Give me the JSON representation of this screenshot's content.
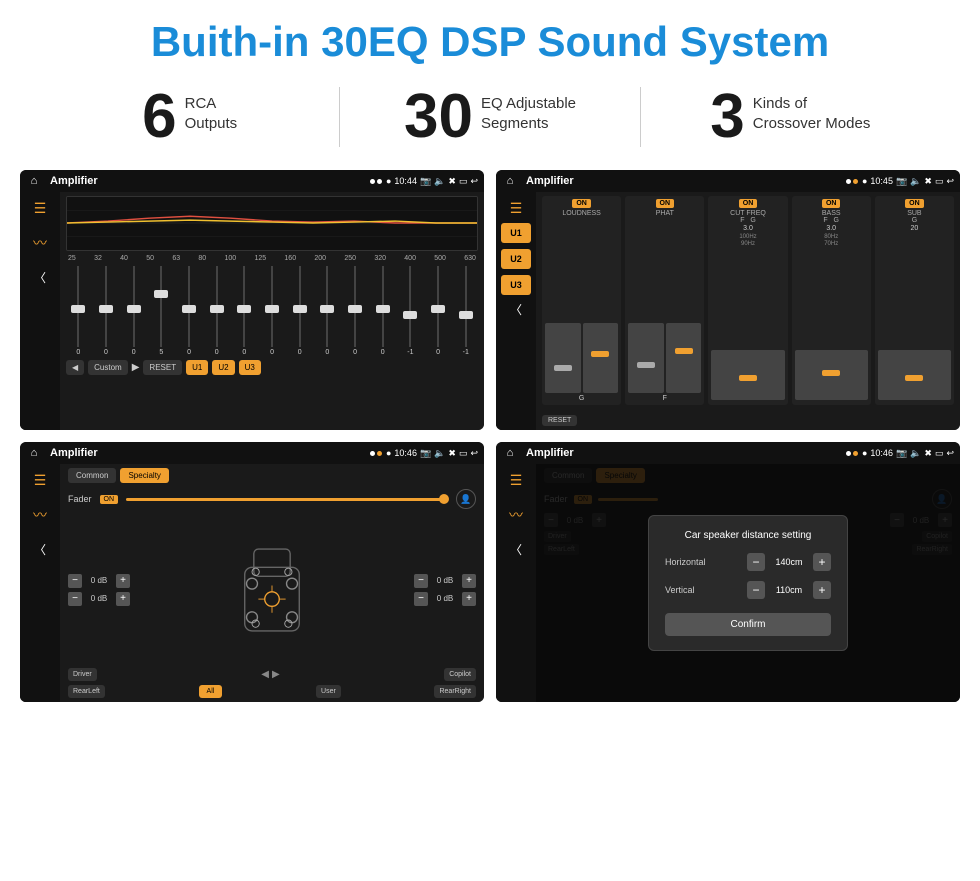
{
  "page": {
    "title": "Buith-in 30EQ DSP Sound System",
    "stats": [
      {
        "number": "6",
        "label": "RCA\nOutputs"
      },
      {
        "number": "30",
        "label": "EQ Adjustable\nSegments"
      },
      {
        "number": "3",
        "label": "Kinds of\nCrossover Modes"
      }
    ],
    "screens": [
      {
        "id": "screen1",
        "status_bar": {
          "time": "10:44",
          "title": "Amplifier"
        },
        "eq_labels": [
          "25",
          "32",
          "40",
          "50",
          "63",
          "80",
          "100",
          "125",
          "160",
          "200",
          "250",
          "320",
          "400",
          "500",
          "630"
        ],
        "eq_values": [
          "0",
          "0",
          "0",
          "5",
          "0",
          "0",
          "0",
          "0",
          "0",
          "0",
          "0",
          "0",
          "-1",
          "0",
          "-1"
        ],
        "eq_preset": "Custom",
        "buttons": [
          "RESET",
          "U1",
          "U2",
          "U3"
        ]
      },
      {
        "id": "screen2",
        "status_bar": {
          "time": "10:45",
          "title": "Amplifier"
        },
        "channels": [
          "LOUDNESS",
          "PHAT",
          "CUT FREQ",
          "BASS",
          "SUB"
        ],
        "u_buttons": [
          "U1",
          "U2",
          "U3"
        ],
        "reset_label": "RESET"
      },
      {
        "id": "screen3",
        "status_bar": {
          "time": "10:46",
          "title": "Amplifier"
        },
        "tabs": [
          "Common",
          "Specialty"
        ],
        "fader_label": "Fader",
        "fader_on": "ON",
        "db_values": [
          "0 dB",
          "0 dB",
          "0 dB",
          "0 dB"
        ],
        "buttons": [
          "Driver",
          "Copilot",
          "RearLeft",
          "All",
          "User",
          "RearRight"
        ]
      },
      {
        "id": "screen4",
        "status_bar": {
          "time": "10:46",
          "title": "Amplifier"
        },
        "tabs": [
          "Common",
          "Specialty"
        ],
        "fader_on": "ON",
        "dialog": {
          "title": "Car speaker distance setting",
          "horizontal_label": "Horizontal",
          "horizontal_value": "140cm",
          "vertical_label": "Vertical",
          "vertical_value": "110cm",
          "confirm_label": "Confirm"
        },
        "db_values": [
          "0 dB",
          "0 dB"
        ],
        "buttons": [
          "Driver",
          "Copilot",
          "RearLeft",
          "All",
          "User",
          "RearRight"
        ]
      }
    ]
  }
}
